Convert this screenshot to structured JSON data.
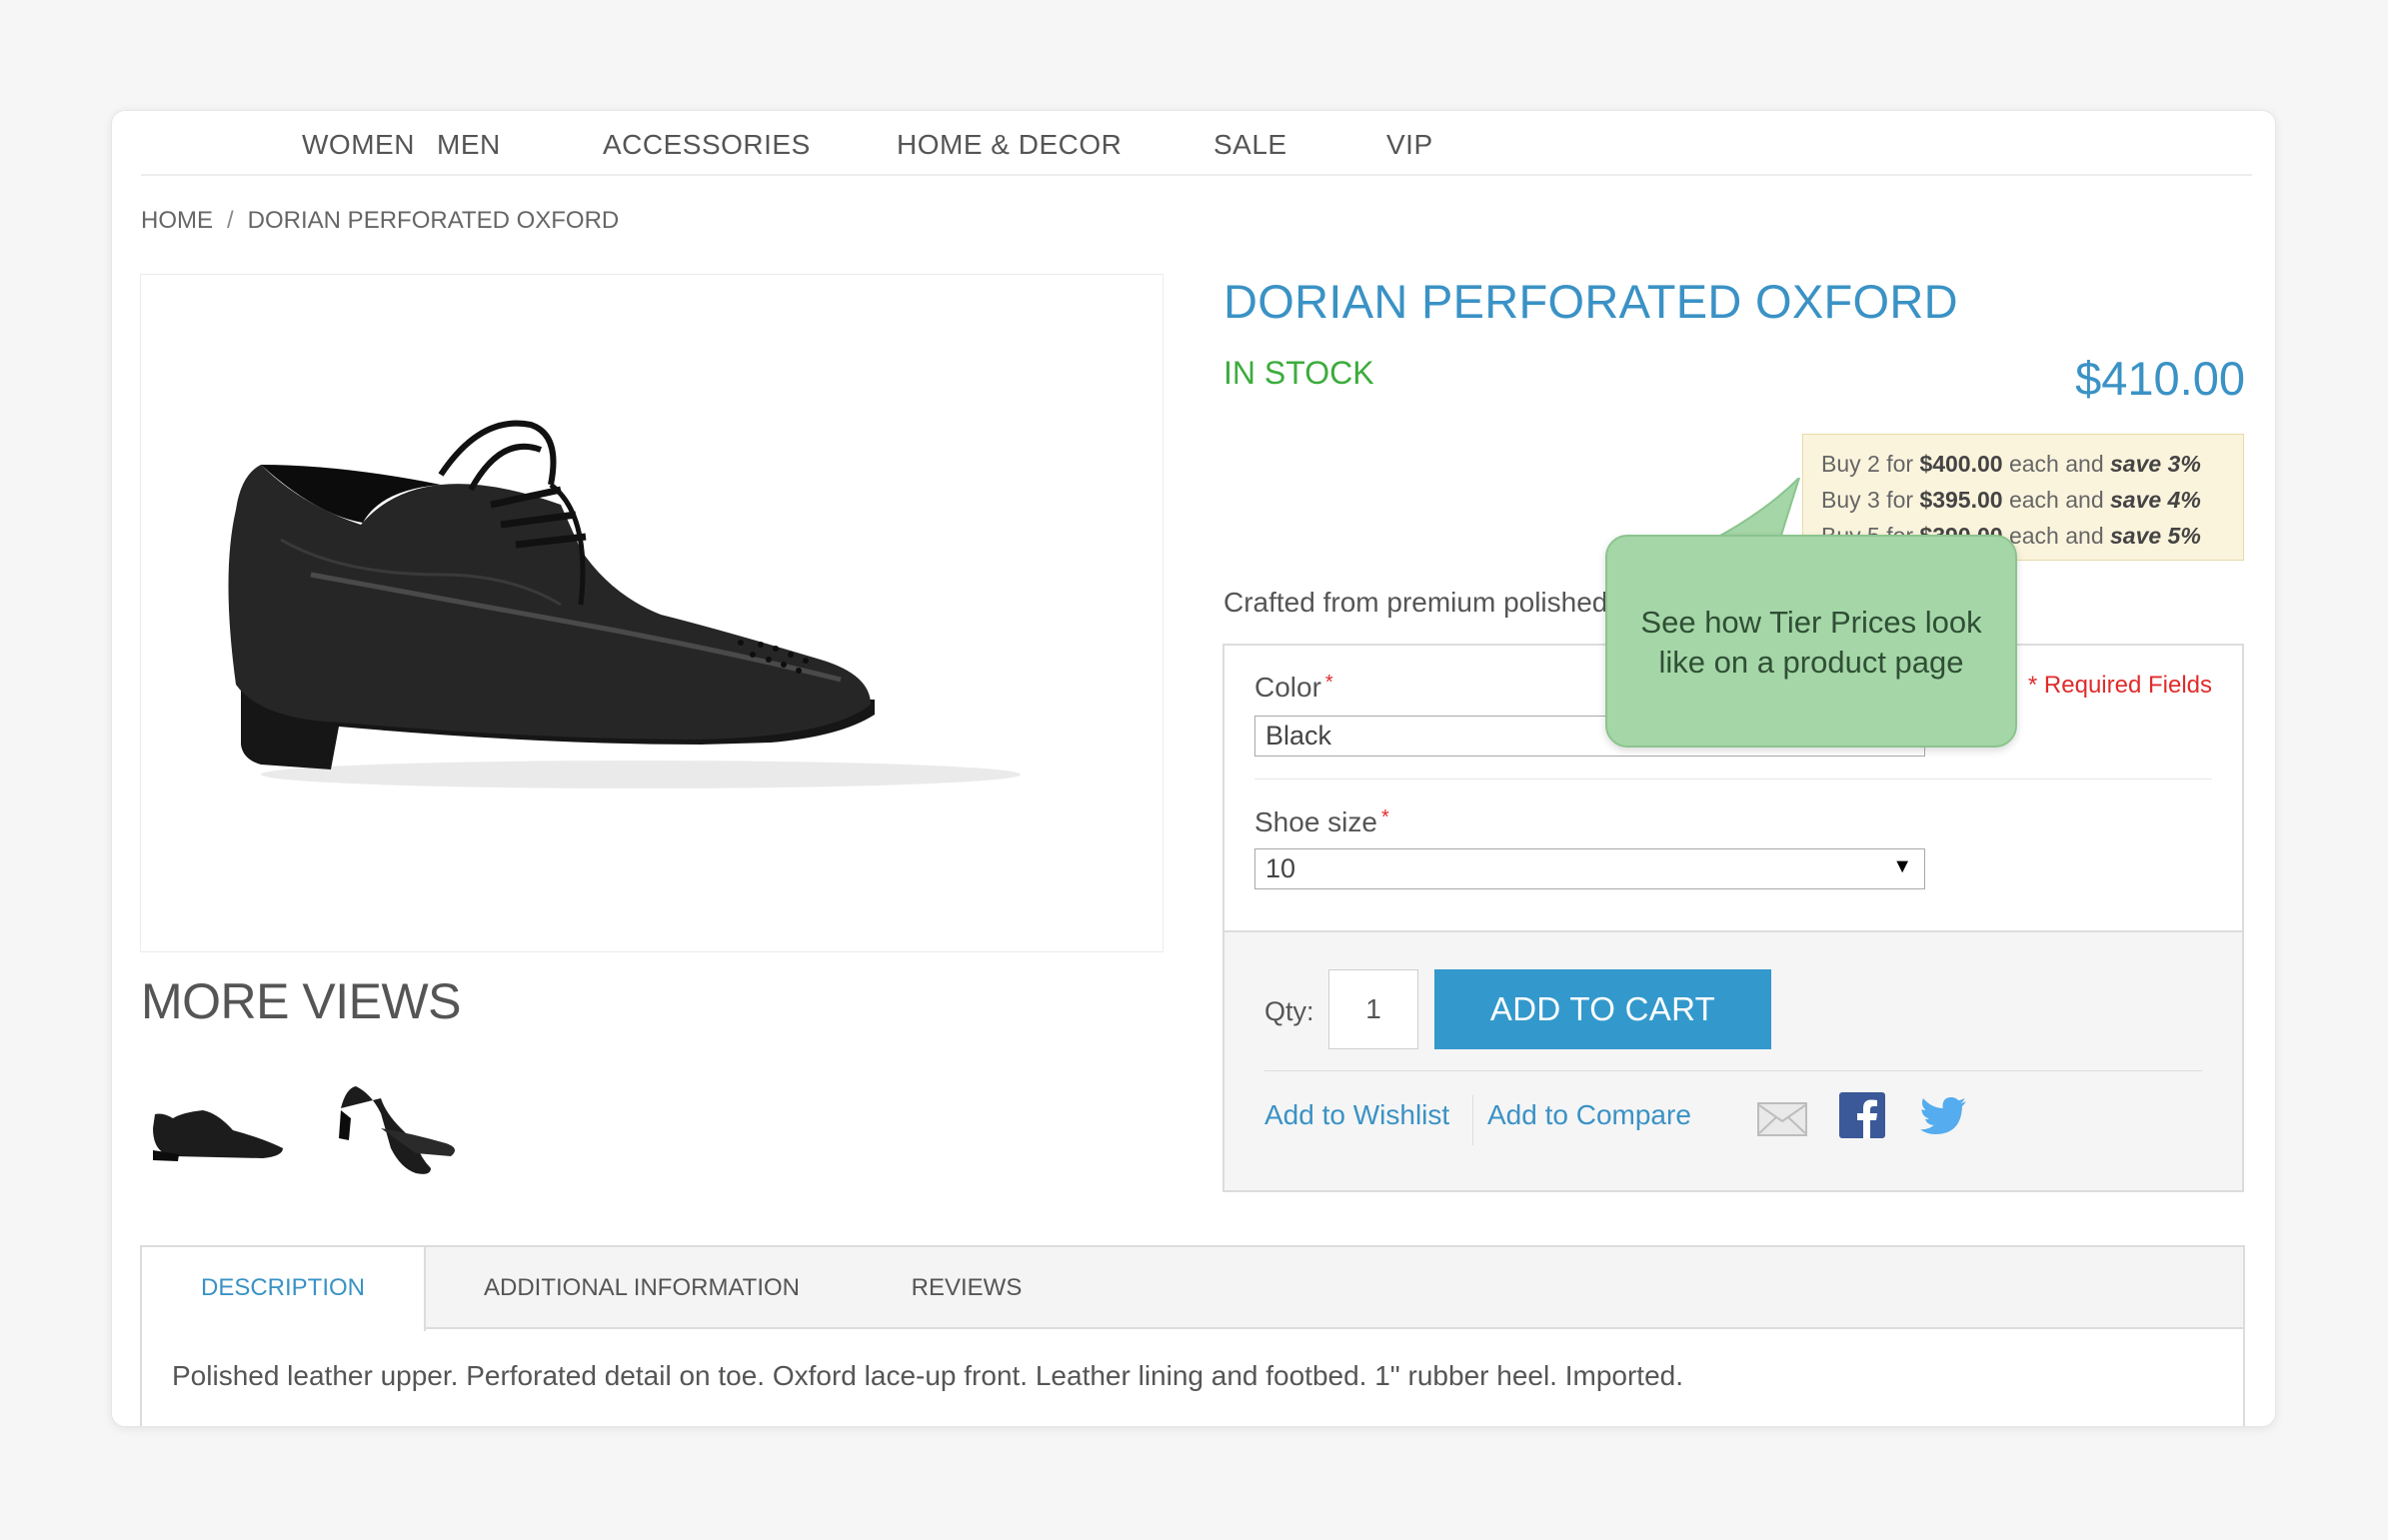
{
  "nav": {
    "items": [
      {
        "label": "WOMEN"
      },
      {
        "label": "MEN"
      },
      {
        "label": "ACCESSORIES"
      },
      {
        "label": "HOME & DECOR"
      },
      {
        "label": "SALE"
      },
      {
        "label": "VIP"
      }
    ]
  },
  "breadcrumb": {
    "home": "HOME",
    "separator": "/",
    "current": "DORIAN PERFORATED OXFORD"
  },
  "product": {
    "title": "DORIAN PERFORATED OXFORD",
    "stock": "IN STOCK",
    "price": "$410.00",
    "short_description": "Crafted from premium polished leather, unrivaled in design"
  },
  "tier_prices": [
    {
      "qty_text": "Buy 2 for ",
      "price": "$400.00",
      "mid": " each and ",
      "save": "save 3%"
    },
    {
      "qty_text": "Buy 3 for ",
      "price": "$395.00",
      "mid": " each and ",
      "save": "save 4%"
    },
    {
      "qty_text": "Buy 5 for ",
      "price": "$390.00",
      "mid": " each and ",
      "save": "save 5%"
    }
  ],
  "options": {
    "required_fields": "* Required Fields",
    "color_label": "Color",
    "color_value": "Black",
    "size_label": "Shoe size",
    "size_value": "10",
    "required_marker": "*"
  },
  "cart": {
    "qty_label": "Qty:",
    "qty_value": "1",
    "add_to_cart": "ADD TO CART",
    "wishlist": "Add to Wishlist",
    "compare": "Add to Compare"
  },
  "more_views": {
    "title": "MORE VIEWS"
  },
  "tooltip": {
    "line1": "See how Tier Prices look",
    "line2": "like on a product page"
  },
  "tabs": {
    "items": [
      {
        "label": "DESCRIPTION"
      },
      {
        "label": "ADDITIONAL INFORMATION"
      },
      {
        "label": "REVIEWS"
      }
    ],
    "content": "Polished leather upper. Perforated detail on toe. Oxford lace-up front. Leather lining and footbed. 1\" rubber heel. Imported."
  },
  "colors": {
    "accent_blue": "#3a92c5",
    "button_blue": "#3399cc",
    "stock_green": "#3cac3c",
    "required_red": "#e02b2b",
    "tooltip_green": "#a5d6a7",
    "tier_bg": "#fbf4dd"
  },
  "icons": {
    "email": "envelope-icon",
    "facebook": "facebook-icon",
    "twitter": "twitter-icon"
  }
}
